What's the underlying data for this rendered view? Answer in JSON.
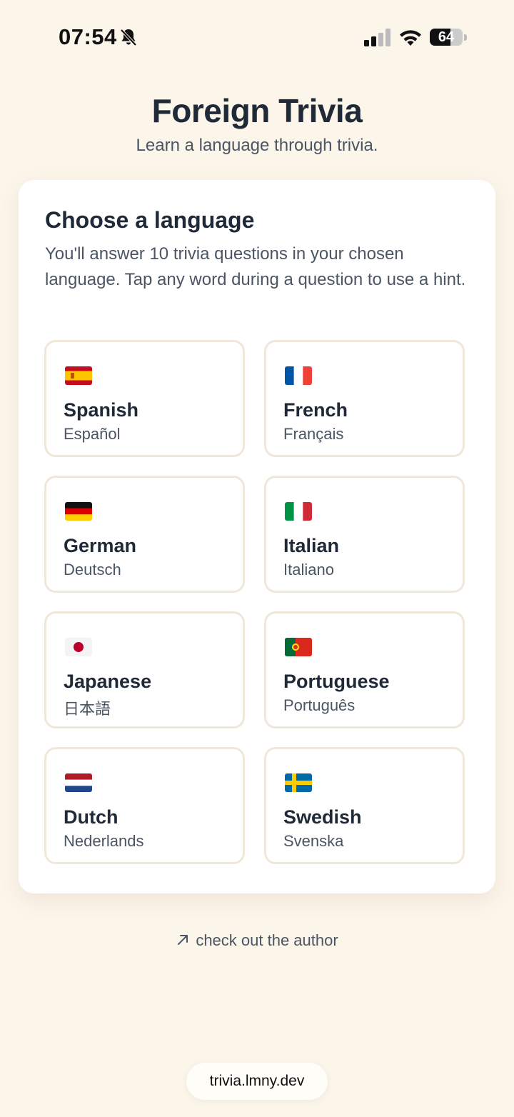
{
  "status_bar": {
    "time": "07:54",
    "battery_percent": 64,
    "battery_label": "64",
    "icons": [
      "bell-muted-icon",
      "signal-icon",
      "wifi-icon",
      "battery-icon"
    ]
  },
  "header": {
    "title": "Foreign Trivia",
    "subtitle": "Learn a language through trivia."
  },
  "card": {
    "title": "Choose a language",
    "description": "You'll answer 10 trivia questions in your chosen language. Tap any word during a question to use a hint."
  },
  "languages": [
    {
      "name": "Spanish",
      "native": "Español",
      "flag": "spain-flag-icon"
    },
    {
      "name": "French",
      "native": "Français",
      "flag": "france-flag-icon"
    },
    {
      "name": "German",
      "native": "Deutsch",
      "flag": "germany-flag-icon"
    },
    {
      "name": "Italian",
      "native": "Italiano",
      "flag": "italy-flag-icon"
    },
    {
      "name": "Japanese",
      "native": "日本語",
      "flag": "japan-flag-icon"
    },
    {
      "name": "Portuguese",
      "native": "Português",
      "flag": "portugal-flag-icon"
    },
    {
      "name": "Dutch",
      "native": "Nederlands",
      "flag": "netherlands-flag-icon"
    },
    {
      "name": "Swedish",
      "native": "Svenska",
      "flag": "sweden-flag-icon"
    }
  ],
  "footer": {
    "author_link": "check out the author",
    "author_link_icon": "arrow-up-right-icon",
    "url": "trivia.lmny.dev"
  },
  "colors": {
    "background": "#fcf5ea",
    "card": "#ffffff",
    "tile_border": "#efe7da",
    "text_primary": "#1f2937",
    "text_secondary": "#4b5563"
  }
}
